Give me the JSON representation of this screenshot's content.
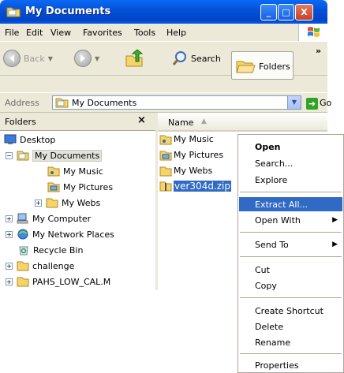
{
  "window": {
    "title": "My Documents",
    "controls": {
      "minimize": "_",
      "maximize": "□",
      "close": "X"
    }
  },
  "menu": {
    "items": [
      "File",
      "Edit",
      "View",
      "Favorites",
      "Tools",
      "Help"
    ]
  },
  "toolbar": {
    "back_label": "Back",
    "search_label": "Search",
    "folders_label": "Folders",
    "overflow": "»"
  },
  "address": {
    "label": "Address",
    "value": "My Documents",
    "go_label": "Go"
  },
  "folders_pane": {
    "title": "Folders",
    "close": "×",
    "tree": [
      {
        "label": "Desktop",
        "icon": "desktop-icon"
      },
      {
        "label": "My Documents",
        "icon": "folder-open-icon",
        "expander": "−"
      },
      {
        "label": "My Music",
        "icon": "my-music-folder-icon"
      },
      {
        "label": "My Pictures",
        "icon": "my-pictures-folder-icon"
      },
      {
        "label": "My Webs",
        "icon": "folder-icon",
        "expander": "+"
      },
      {
        "label": "My Computer",
        "icon": "computer-icon",
        "expander": "+"
      },
      {
        "label": "My Network Places",
        "icon": "network-icon",
        "expander": "+"
      },
      {
        "label": "Recycle Bin",
        "icon": "recycle-bin-icon"
      },
      {
        "label": "challenge",
        "icon": "folder-icon",
        "expander": "+"
      },
      {
        "label": "PAHS_LOW_CAL.M",
        "icon": "folder-icon",
        "expander": "+"
      }
    ]
  },
  "file_list": {
    "column_name": "Name",
    "sort_indicator": "▲",
    "items": [
      {
        "label": "My Music",
        "icon": "my-music-folder-icon"
      },
      {
        "label": "My Pictures",
        "icon": "my-pictures-folder-icon"
      },
      {
        "label": "My Webs",
        "icon": "folder-icon"
      },
      {
        "label": "ver304d.zip",
        "icon": "zip-folder-icon",
        "selected": true
      }
    ]
  },
  "context_menu": {
    "items": [
      "Open",
      "Search...",
      "Explore",
      "Extract All...",
      "Open With",
      "Send To",
      "Cut",
      "Copy",
      "Create Shortcut",
      "Delete",
      "Rename",
      "Properties"
    ],
    "submenu_arrow": "▶",
    "highlighted": "Extract All..."
  },
  "colors": {
    "titlebar": "#0552d6",
    "selection": "#316ac5",
    "chrome": "#ece9d8"
  }
}
